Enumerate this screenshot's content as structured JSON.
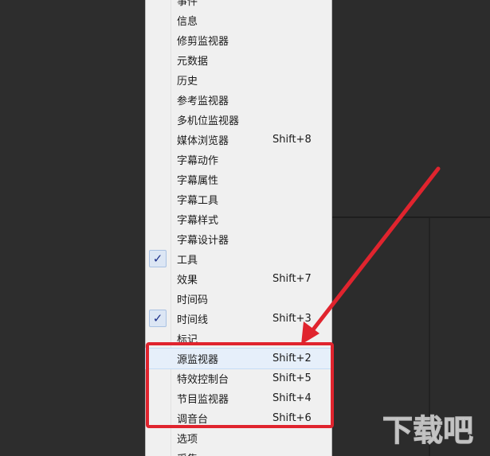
{
  "menu": {
    "items": [
      {
        "label": "事件",
        "shortcut": "",
        "checked": false
      },
      {
        "label": "信息",
        "shortcut": "",
        "checked": false
      },
      {
        "label": "修剪监视器",
        "shortcut": "",
        "checked": false
      },
      {
        "label": "元数据",
        "shortcut": "",
        "checked": false
      },
      {
        "label": "历史",
        "shortcut": "",
        "checked": false
      },
      {
        "label": "参考监视器",
        "shortcut": "",
        "checked": false
      },
      {
        "label": "多机位监视器",
        "shortcut": "",
        "checked": false
      },
      {
        "label": "媒体浏览器",
        "shortcut": "Shift+8",
        "checked": false
      },
      {
        "label": "字幕动作",
        "shortcut": "",
        "checked": false
      },
      {
        "label": "字幕属性",
        "shortcut": "",
        "checked": false
      },
      {
        "label": "字幕工具",
        "shortcut": "",
        "checked": false
      },
      {
        "label": "字幕样式",
        "shortcut": "",
        "checked": false
      },
      {
        "label": "字幕设计器",
        "shortcut": "",
        "checked": false
      },
      {
        "label": "工具",
        "shortcut": "",
        "checked": true
      },
      {
        "label": "效果",
        "shortcut": "Shift+7",
        "checked": false
      },
      {
        "label": "时间码",
        "shortcut": "",
        "checked": false
      },
      {
        "label": "时间线",
        "shortcut": "Shift+3",
        "checked": true
      },
      {
        "label": "标记",
        "shortcut": "",
        "checked": false
      },
      {
        "label": "源监视器",
        "shortcut": "Shift+2",
        "checked": false
      },
      {
        "label": "特效控制台",
        "shortcut": "Shift+5",
        "checked": false
      },
      {
        "label": "节目监视器",
        "shortcut": "Shift+4",
        "checked": false
      },
      {
        "label": "调音台",
        "shortcut": "Shift+6",
        "checked": false
      },
      {
        "label": "选项",
        "shortcut": "",
        "checked": false
      },
      {
        "label": "采集",
        "shortcut": "",
        "checked": false
      }
    ],
    "check_glyph": "✓"
  },
  "annotation": {
    "color": "#e0242e"
  },
  "watermark": {
    "text": "下载吧"
  }
}
